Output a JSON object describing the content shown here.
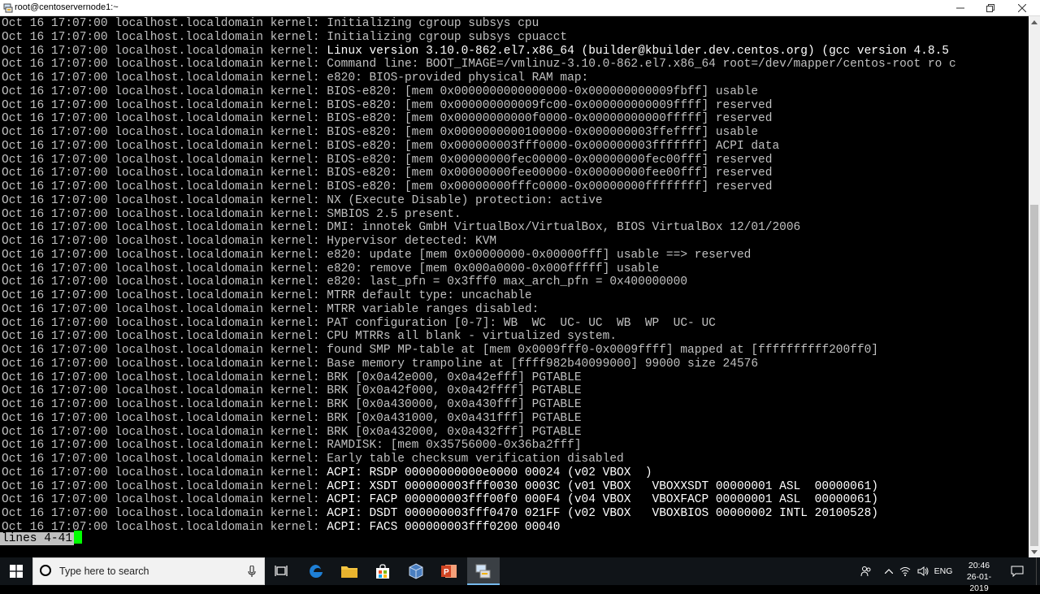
{
  "window": {
    "title": "root@centoservernode1:~"
  },
  "terminal": {
    "lines": [
      {
        "prefix": "Oct 16 17:07:00 localhost.localdomain kernel: ",
        "message": "Initializing cgroup subsys cpu",
        "bright": false
      },
      {
        "prefix": "Oct 16 17:07:00 localhost.localdomain kernel: ",
        "message": "Initializing cgroup subsys cpuacct",
        "bright": false
      },
      {
        "prefix": "Oct 16 17:07:00 localhost.localdomain kernel: ",
        "message": "Linux version 3.10.0-862.el7.x86_64 (builder@kbuilder.dev.centos.org) (gcc version 4.8.5",
        "bright": true
      },
      {
        "prefix": "Oct 16 17:07:00 localhost.localdomain kernel: ",
        "message": "Command line: BOOT_IMAGE=/vmlinuz-3.10.0-862.el7.x86_64 root=/dev/mapper/centos-root ro c",
        "bright": false
      },
      {
        "prefix": "Oct 16 17:07:00 localhost.localdomain kernel: ",
        "message": "e820: BIOS-provided physical RAM map:",
        "bright": false
      },
      {
        "prefix": "Oct 16 17:07:00 localhost.localdomain kernel: ",
        "message": "BIOS-e820: [mem 0x0000000000000000-0x000000000009fbff] usable",
        "bright": false
      },
      {
        "prefix": "Oct 16 17:07:00 localhost.localdomain kernel: ",
        "message": "BIOS-e820: [mem 0x000000000009fc00-0x000000000009ffff] reserved",
        "bright": false
      },
      {
        "prefix": "Oct 16 17:07:00 localhost.localdomain kernel: ",
        "message": "BIOS-e820: [mem 0x00000000000f0000-0x00000000000fffff] reserved",
        "bright": false
      },
      {
        "prefix": "Oct 16 17:07:00 localhost.localdomain kernel: ",
        "message": "BIOS-e820: [mem 0x0000000000100000-0x000000003ffeffff] usable",
        "bright": false
      },
      {
        "prefix": "Oct 16 17:07:00 localhost.localdomain kernel: ",
        "message": "BIOS-e820: [mem 0x000000003fff0000-0x000000003fffffff] ACPI data",
        "bright": false
      },
      {
        "prefix": "Oct 16 17:07:00 localhost.localdomain kernel: ",
        "message": "BIOS-e820: [mem 0x00000000fec00000-0x00000000fec00fff] reserved",
        "bright": false
      },
      {
        "prefix": "Oct 16 17:07:00 localhost.localdomain kernel: ",
        "message": "BIOS-e820: [mem 0x00000000fee00000-0x00000000fee00fff] reserved",
        "bright": false
      },
      {
        "prefix": "Oct 16 17:07:00 localhost.localdomain kernel: ",
        "message": "BIOS-e820: [mem 0x00000000fffc0000-0x00000000ffffffff] reserved",
        "bright": false
      },
      {
        "prefix": "Oct 16 17:07:00 localhost.localdomain kernel: ",
        "message": "NX (Execute Disable) protection: active",
        "bright": false
      },
      {
        "prefix": "Oct 16 17:07:00 localhost.localdomain kernel: ",
        "message": "SMBIOS 2.5 present.",
        "bright": false
      },
      {
        "prefix": "Oct 16 17:07:00 localhost.localdomain kernel: ",
        "message": "DMI: innotek GmbH VirtualBox/VirtualBox, BIOS VirtualBox 12/01/2006",
        "bright": false
      },
      {
        "prefix": "Oct 16 17:07:00 localhost.localdomain kernel: ",
        "message": "Hypervisor detected: KVM",
        "bright": false
      },
      {
        "prefix": "Oct 16 17:07:00 localhost.localdomain kernel: ",
        "message": "e820: update [mem 0x00000000-0x00000fff] usable ==> reserved",
        "bright": false
      },
      {
        "prefix": "Oct 16 17:07:00 localhost.localdomain kernel: ",
        "message": "e820: remove [mem 0x000a0000-0x000fffff] usable",
        "bright": false
      },
      {
        "prefix": "Oct 16 17:07:00 localhost.localdomain kernel: ",
        "message": "e820: last_pfn = 0x3fff0 max_arch_pfn = 0x400000000",
        "bright": false
      },
      {
        "prefix": "Oct 16 17:07:00 localhost.localdomain kernel: ",
        "message": "MTRR default type: uncachable",
        "bright": false
      },
      {
        "prefix": "Oct 16 17:07:00 localhost.localdomain kernel: ",
        "message": "MTRR variable ranges disabled:",
        "bright": false
      },
      {
        "prefix": "Oct 16 17:07:00 localhost.localdomain kernel: ",
        "message": "PAT configuration [0-7]: WB  WC  UC- UC  WB  WP  UC- UC",
        "bright": false
      },
      {
        "prefix": "Oct 16 17:07:00 localhost.localdomain kernel: ",
        "message": "CPU MTRRs all blank - virtualized system.",
        "bright": false
      },
      {
        "prefix": "Oct 16 17:07:00 localhost.localdomain kernel: ",
        "message": "found SMP MP-table at [mem 0x0009fff0-0x0009ffff] mapped at [ffffffffff200ff0]",
        "bright": false
      },
      {
        "prefix": "Oct 16 17:07:00 localhost.localdomain kernel: ",
        "message": "Base memory trampoline at [ffff982b40099000] 99000 size 24576",
        "bright": false
      },
      {
        "prefix": "Oct 16 17:07:00 localhost.localdomain kernel: ",
        "message": "BRK [0x0a42e000, 0x0a42efff] PGTABLE",
        "bright": false
      },
      {
        "prefix": "Oct 16 17:07:00 localhost.localdomain kernel: ",
        "message": "BRK [0x0a42f000, 0x0a42ffff] PGTABLE",
        "bright": false
      },
      {
        "prefix": "Oct 16 17:07:00 localhost.localdomain kernel: ",
        "message": "BRK [0x0a430000, 0x0a430fff] PGTABLE",
        "bright": false
      },
      {
        "prefix": "Oct 16 17:07:00 localhost.localdomain kernel: ",
        "message": "BRK [0x0a431000, 0x0a431fff] PGTABLE",
        "bright": false
      },
      {
        "prefix": "Oct 16 17:07:00 localhost.localdomain kernel: ",
        "message": "BRK [0x0a432000, 0x0a432fff] PGTABLE",
        "bright": false
      },
      {
        "prefix": "Oct 16 17:07:00 localhost.localdomain kernel: ",
        "message": "RAMDISK: [mem 0x35756000-0x36ba2fff]",
        "bright": false
      },
      {
        "prefix": "Oct 16 17:07:00 localhost.localdomain kernel: ",
        "message": "Early table checksum verification disabled",
        "bright": false
      },
      {
        "prefix": "Oct 16 17:07:00 localhost.localdomain kernel: ",
        "message": "ACPI: RSDP 00000000000e0000 00024 (v02 VBOX  )",
        "bright": true
      },
      {
        "prefix": "Oct 16 17:07:00 localhost.localdomain kernel: ",
        "message": "ACPI: XSDT 000000003fff0030 0003C (v01 VBOX   VBOXXSDT 00000001 ASL  00000061)",
        "bright": true
      },
      {
        "prefix": "Oct 16 17:07:00 localhost.localdomain kernel: ",
        "message": "ACPI: FACP 000000003fff00f0 000F4 (v04 VBOX   VBOXFACP 00000001 ASL  00000061)",
        "bright": true
      },
      {
        "prefix": "Oct 16 17:07:00 localhost.localdomain kernel: ",
        "message": "ACPI: DSDT 000000003fff0470 021FF (v02 VBOX   VBOXBIOS 00000002 INTL 20100528)",
        "bright": true
      },
      {
        "prefix": "Oct 16 17:07:00 localhost.localdomain kernel: ",
        "message": "ACPI: FACS 000000003fff0200 00040",
        "bright": true
      }
    ],
    "status": "lines 4-41"
  },
  "taskbar": {
    "search_placeholder": "Type here to search",
    "language": "ENG",
    "time": "20:46",
    "date": "26-01-2019"
  },
  "colors": {
    "terminal_bg": "#000000",
    "terminal_fg": "#c0c0c0",
    "terminal_bright": "#ffffff",
    "cursor": "#00ff00",
    "taskbar_bg": "#101418"
  },
  "icons": {
    "app": "putty-icon",
    "start": "windows-logo-icon",
    "search": "search-circle-icon",
    "mic": "microphone-icon",
    "taskview": "task-view-icon",
    "edge": "edge-icon",
    "explorer": "folder-icon",
    "store": "store-icon",
    "box": "cube-icon",
    "ppt": "powerpoint-icon",
    "putty": "putty-icon",
    "tray_person": "people-icon",
    "tray_chevron": "chevron-up-icon",
    "tray_network": "network-icon",
    "tray_volume": "volume-icon",
    "notifications": "notification-icon"
  }
}
